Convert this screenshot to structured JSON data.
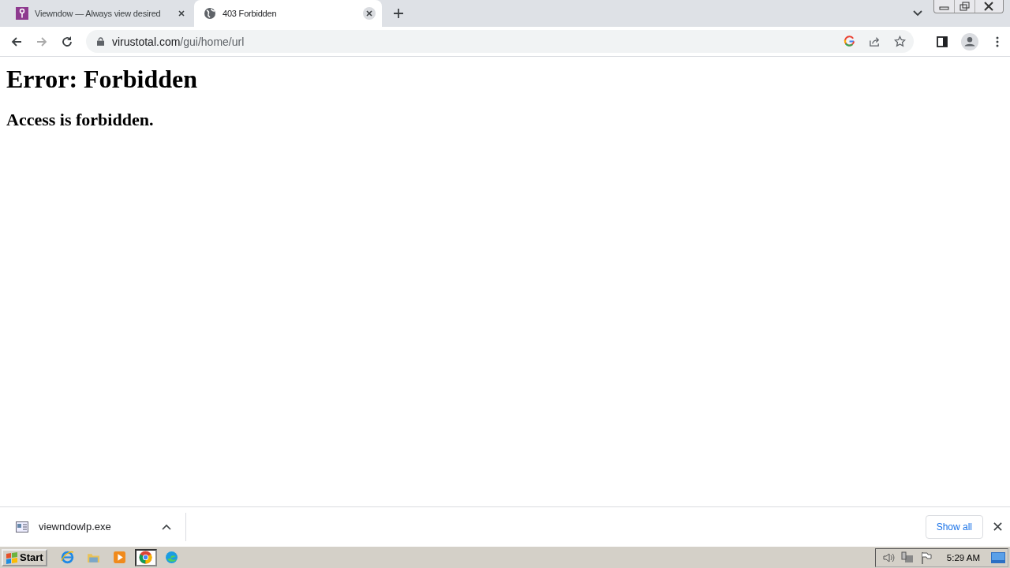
{
  "tabs": [
    {
      "title": "Viewndow — Always view desired",
      "kind": "app",
      "selected": false
    },
    {
      "title": "403 Forbidden",
      "kind": "globe",
      "selected": true
    }
  ],
  "address_bar": {
    "host": "virustotal.com",
    "path": "/gui/home/url"
  },
  "page": {
    "heading": "Error: Forbidden",
    "message": "Access is forbidden."
  },
  "download_bar": {
    "file": "viewndowlp.exe",
    "show_all": "Show all"
  },
  "taskbar": {
    "start": "Start",
    "apps": [
      {
        "kind": "ie",
        "selected": false
      },
      {
        "kind": "folder",
        "selected": false
      },
      {
        "kind": "media",
        "selected": false
      },
      {
        "kind": "chrome",
        "selected": true
      },
      {
        "kind": "edge",
        "selected": false
      }
    ],
    "clock": "5:29 AM"
  }
}
